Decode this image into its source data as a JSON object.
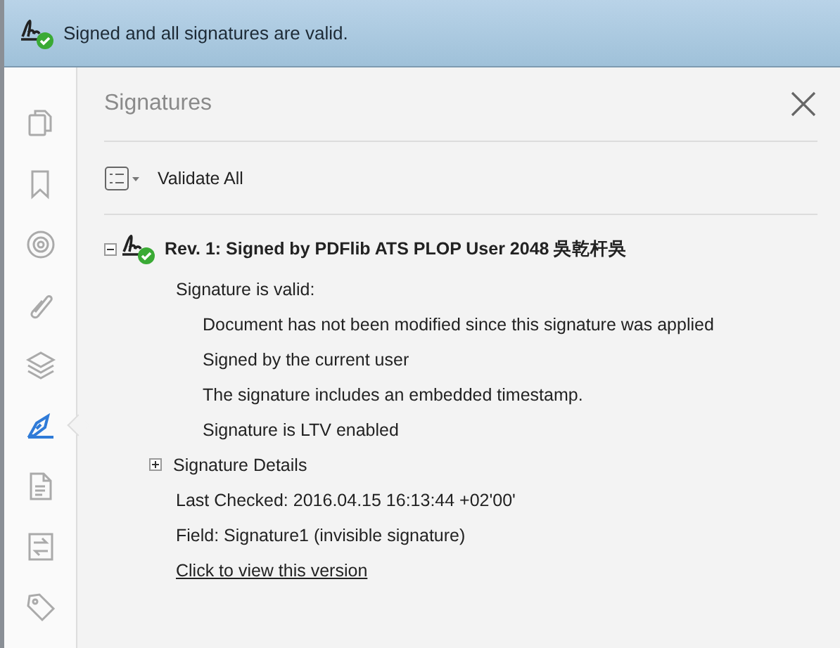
{
  "banner": {
    "text": "Signed and all signatures are valid."
  },
  "sidebar": {
    "items": [
      {
        "kind": "pages",
        "selected": false
      },
      {
        "kind": "bookmark",
        "selected": false
      },
      {
        "kind": "target",
        "selected": false
      },
      {
        "kind": "attachment",
        "selected": false
      },
      {
        "kind": "layers",
        "selected": false
      },
      {
        "kind": "signature",
        "selected": true
      },
      {
        "kind": "document",
        "selected": false
      },
      {
        "kind": "compare",
        "selected": false
      },
      {
        "kind": "tag",
        "selected": false
      }
    ]
  },
  "panel": {
    "title": "Signatures",
    "toolbar": {
      "action": "Validate All"
    },
    "signature": {
      "title": "Rev. 1: Signed by PDFlib ATS PLOP User 2048 吳乾杆吳",
      "expanded": true,
      "status": "Signature is valid:",
      "checks": [
        "Document has not been modified since this signature was applied",
        "Signed by the current user",
        "The signature includes an embedded timestamp.",
        "Signature is LTV enabled"
      ],
      "details": {
        "label": "Signature Details",
        "expanded": false
      },
      "last_checked": "Last Checked: 2016.04.15 16:13:44 +02'00'",
      "field": "Field: Signature1 (invisible signature)",
      "link": "Click to view this version"
    }
  }
}
